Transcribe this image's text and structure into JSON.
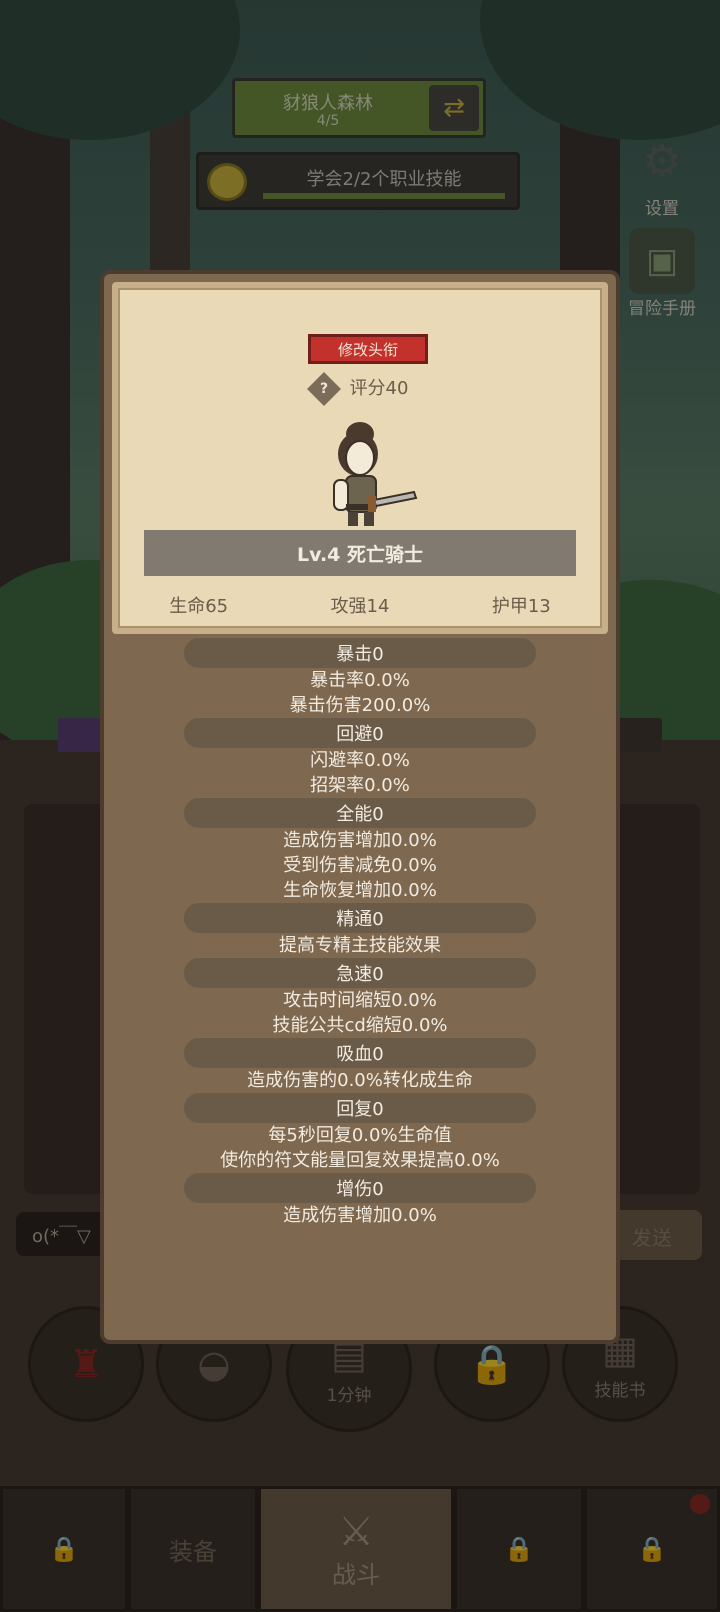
{
  "hud": {
    "location_name": "豺狼人森林",
    "location_progress": "4/5",
    "task_text": "学会2/2个职业技能",
    "settings_label": "设置",
    "handbook_label": "冒险手册"
  },
  "dialog": {
    "rename_button": "修改头衔",
    "score_icon": "?",
    "score_text": "评分40",
    "character_name": "Lv.4 死亡骑士",
    "stats": [
      "生命65",
      "攻强14",
      "护甲13"
    ],
    "attributes": [
      {
        "header": "暴击0",
        "lines": [
          "暴击率0.0%",
          "暴击伤害200.0%"
        ]
      },
      {
        "header": "回避0",
        "lines": [
          "闪避率0.0%",
          "招架率0.0%"
        ]
      },
      {
        "header": "全能0",
        "lines": [
          "造成伤害增加0.0%",
          "受到伤害减免0.0%",
          "生命恢复增加0.0%"
        ]
      },
      {
        "header": "精通0",
        "lines": [
          "提高专精主技能效果"
        ]
      },
      {
        "header": "急速0",
        "lines": [
          "攻击时间缩短0.0%",
          "技能公共cd缩短0.0%"
        ]
      },
      {
        "header": "吸血0",
        "lines": [
          "造成伤害的0.0%转化成生命"
        ]
      },
      {
        "header": "回复0",
        "lines": [
          "每5秒回复0.0%生命值",
          "使你的符文能量回复效果提高0.0%"
        ]
      },
      {
        "header": "增伤0",
        "lines": [
          "造成伤害增加0.0%"
        ]
      }
    ]
  },
  "background_ui": {
    "chat_text": "o(*￣▽",
    "send_label": "发送",
    "chest_timer": "1分钟",
    "skillbook_label": "技能书",
    "tabs": {
      "equipment": "装备",
      "battle": "战斗"
    }
  }
}
